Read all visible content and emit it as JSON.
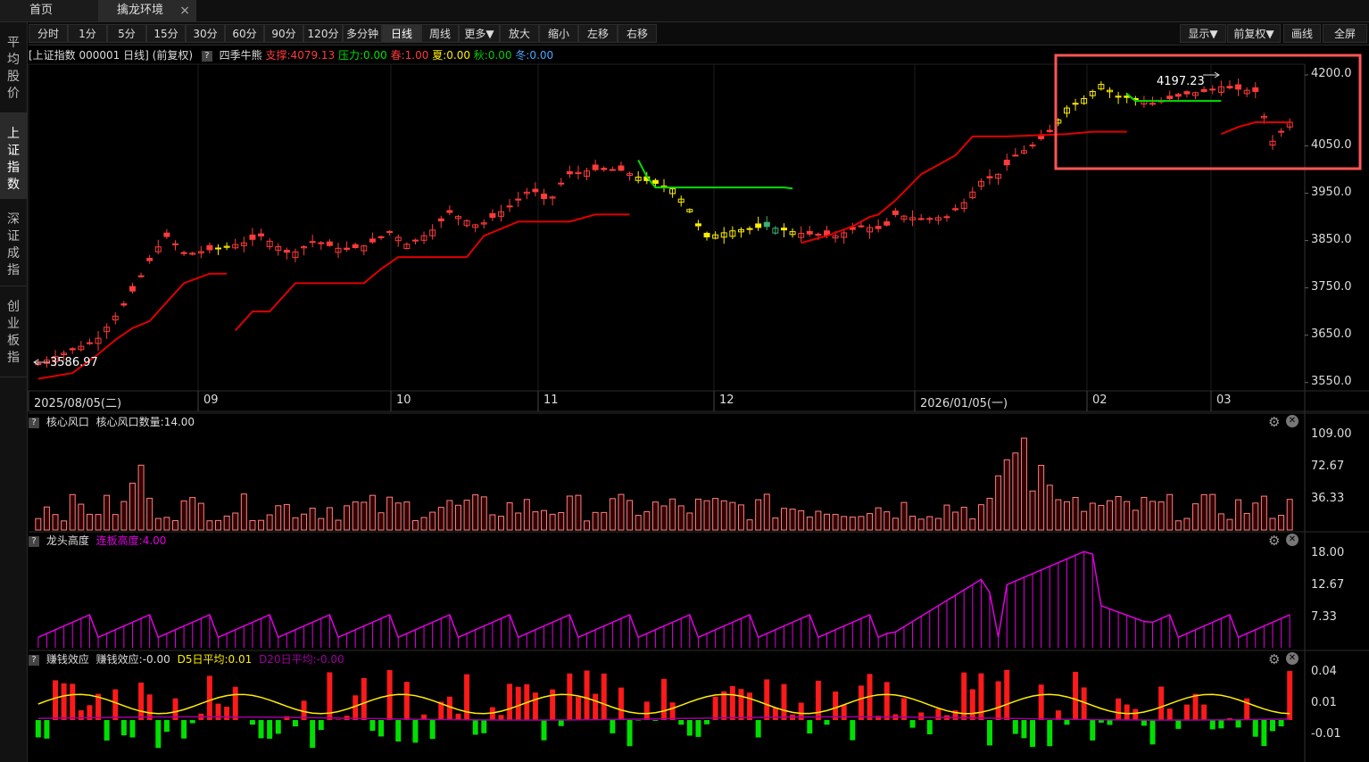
{
  "tabs": [
    {
      "label": "首页",
      "active": false
    },
    {
      "label": "擒龙环境",
      "active": true,
      "close": "×"
    }
  ],
  "toolbar": {
    "left": [
      "分时",
      "1分",
      "5分",
      "15分",
      "30分",
      "60分",
      "90分",
      "120分",
      "多分钟",
      "日线",
      "周线",
      "更多▼",
      "放大",
      "缩小",
      "左移",
      "右移"
    ],
    "selected": "日线",
    "right": [
      "显示▼",
      "前复权▼",
      "画线",
      "全屏"
    ]
  },
  "sidebar": [
    {
      "label": "平均股价",
      "selected": false
    },
    {
      "label": "上证指数",
      "selected": true
    },
    {
      "label": "深证成指",
      "selected": false
    },
    {
      "label": "创业板指",
      "selected": false
    }
  ],
  "info": {
    "title": "[上证指数 000001 日线]",
    "adjust": "(前复权)",
    "q": "?",
    "indicator": "四季牛熊",
    "support": "支撑:4079.13",
    "pressure": "压力:0.00",
    "spring": "春:1.00",
    "summer": "夏:0.00",
    "autumn": "秋:0.00",
    "winter": "冬:0.00"
  },
  "colors": {
    "up": "#ff3b3b",
    "down": "#00d0d0",
    "support": "#e00000",
    "pressure": "#00e000",
    "yellow": "#ffee00",
    "green_candle": "#3cb371",
    "magenta": "#e000e0",
    "purple": "#a000a0",
    "bg": "#000000",
    "grid": "#222222"
  },
  "main_chart": {
    "y_ticks": [
      "4200.0",
      "4050.0",
      "3950.0",
      "3850.0",
      "3750.0",
      "3650.0",
      "3550.0"
    ],
    "x_ticks": [
      "2025/08/05(二)",
      "09",
      "10",
      "11",
      "12",
      "2026/01/05(一)",
      "02",
      "03"
    ],
    "max_label": "4197.23",
    "min_label": "3586.97",
    "ylim": [
      3540,
      4215
    ]
  },
  "panel1": {
    "q": "?",
    "name": "核心风口",
    "value_text": "核心风口数量:14.00",
    "y_ticks": [
      "109.00",
      "72.67",
      "36.33"
    ]
  },
  "panel2": {
    "q": "?",
    "name": "龙头高度",
    "value_text": "连板高度:4.00",
    "y_ticks": [
      "18.00",
      "12.67",
      "7.33"
    ]
  },
  "panel3": {
    "q": "?",
    "name": "赚钱效应",
    "value_text": "赚钱效应:-0.00",
    "d5": "D5日平均:0.01",
    "d20": "D20日平均:-0.00",
    "y_ticks": [
      "0.04",
      "0.01",
      "-0.01"
    ]
  },
  "panel_btns": {
    "gear": "⚙",
    "close": "✕"
  }
}
